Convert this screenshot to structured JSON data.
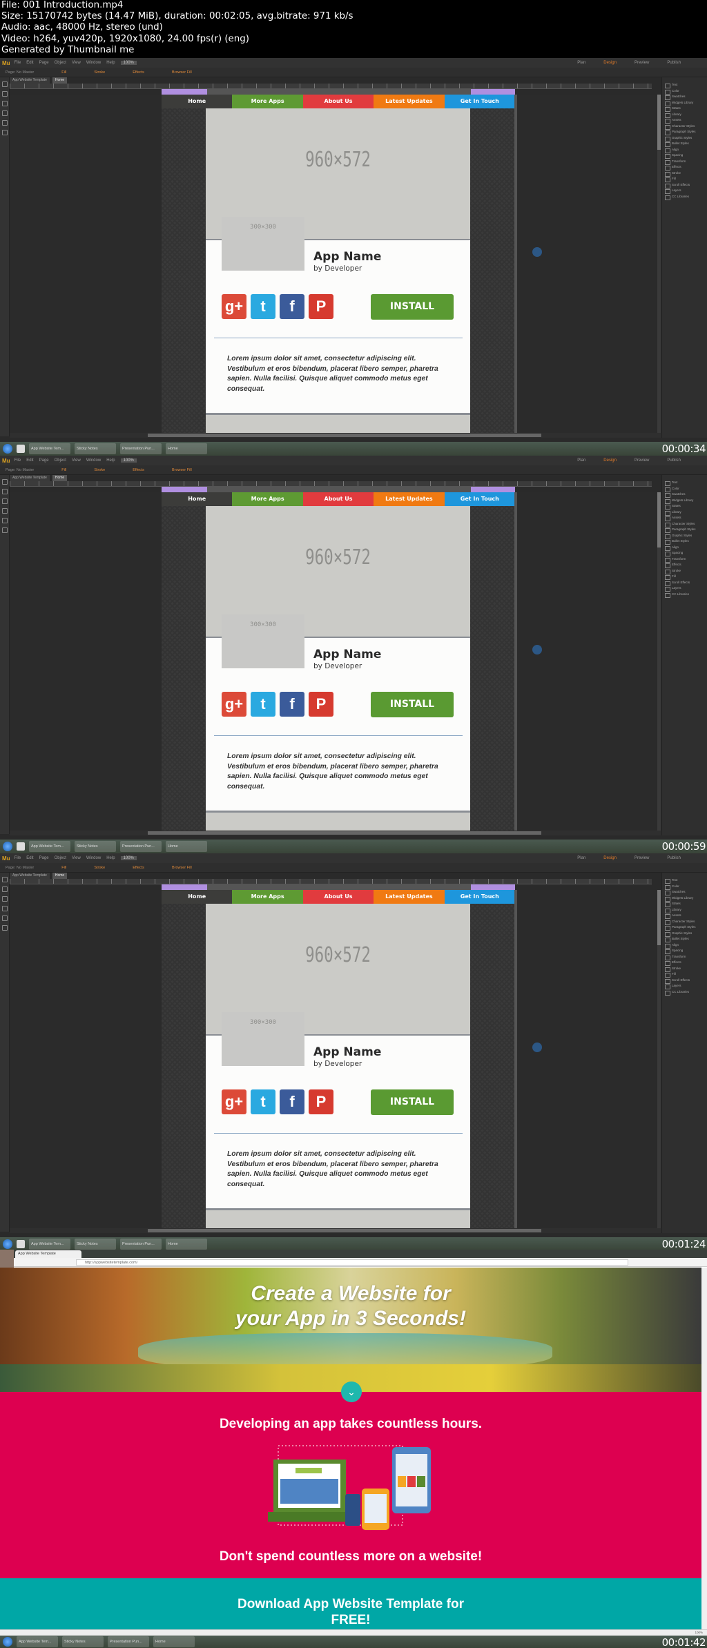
{
  "info": {
    "lines": [
      "File: 001 Introduction.mp4",
      "Size: 15170742 bytes (14.47 MiB), duration: 00:02:05, avg.bitrate: 971 kb/s",
      "Audio: aac, 48000 Hz, stereo (und)",
      "Video: h264, yuv420p, 1920x1080, 24.00 fps(r) (eng)",
      "Generated by Thumbnail me"
    ]
  },
  "editor": {
    "logo": "Mu",
    "menu": [
      "File",
      "Edit",
      "Page",
      "Object",
      "View",
      "Window",
      "Help"
    ],
    "zoom": "100%",
    "modes": [
      "Plan",
      "Design",
      "Preview",
      "Publish"
    ],
    "active_mode": "Design",
    "control_labels": [
      "Page: No Master",
      "Fill",
      "Stroke",
      "Effects",
      "Browser Fill"
    ],
    "doc_tabs": [
      "App Website Template",
      "Home"
    ],
    "nav": [
      {
        "label": "Home",
        "color": "#3c3c3a"
      },
      {
        "label": "More Apps",
        "color": "#5e9a33"
      },
      {
        "label": "About Us",
        "color": "#e13b3e"
      },
      {
        "label": "Latest Updates",
        "color": "#f07a12"
      },
      {
        "label": "Get In Touch",
        "color": "#1e96dc"
      }
    ],
    "hero_placeholder": "960×572",
    "thumb_placeholder": "300×300",
    "app_name": "App Name",
    "developer": "by Developer",
    "social": [
      {
        "icon": "google-plus-icon",
        "glyph": "g+",
        "color": "#dc4a38"
      },
      {
        "icon": "twitter-icon",
        "glyph": "t",
        "color": "#2aa9e0"
      },
      {
        "icon": "facebook-icon",
        "glyph": "f",
        "color": "#3b5b9a"
      },
      {
        "icon": "pinterest-icon",
        "glyph": "P",
        "color": "#d63a2f"
      }
    ],
    "install": "INSTALL",
    "lorem": "Lorem ipsum dolor sit amet, consectetur adipiscing elit. Vestibulum et eros bibendum, placerat libero semper, pharetra sapien. Nulla facilisi. Quisque aliquet commodo metus eget consequat.",
    "panels": [
      "Text",
      "Color",
      "Swatches",
      "Widgets Library",
      "States",
      "Library",
      "Assets",
      "Character Styles",
      "Paragraph Styles",
      "Graphic Styles",
      "Bullet Styles",
      "Align",
      "Spacing",
      "Transform",
      "Effects",
      "Stroke",
      "Fill",
      "Scroll Effects",
      "Layers",
      "CC Libraries"
    ]
  },
  "taskbar": {
    "apps": [
      "App Website Tem...",
      "Sticky Notes",
      "Presentation Pun...",
      "Home"
    ]
  },
  "frames": [
    {
      "timestamp": "00:00:34"
    },
    {
      "timestamp": "00:00:59"
    },
    {
      "timestamp": "00:01:24"
    }
  ],
  "browser": {
    "tab": "App Website Template",
    "url": "http://appwebsitetemplate.com/",
    "hero_title": "Create a Website for your App in 3 Seconds!",
    "heading1": "Developing an app takes countless hours.",
    "heading2": "Don't spend countless more on a website!",
    "cta": "Download App Website Template for FREE!",
    "zoom": "100%",
    "timestamp": "00:01:42"
  }
}
